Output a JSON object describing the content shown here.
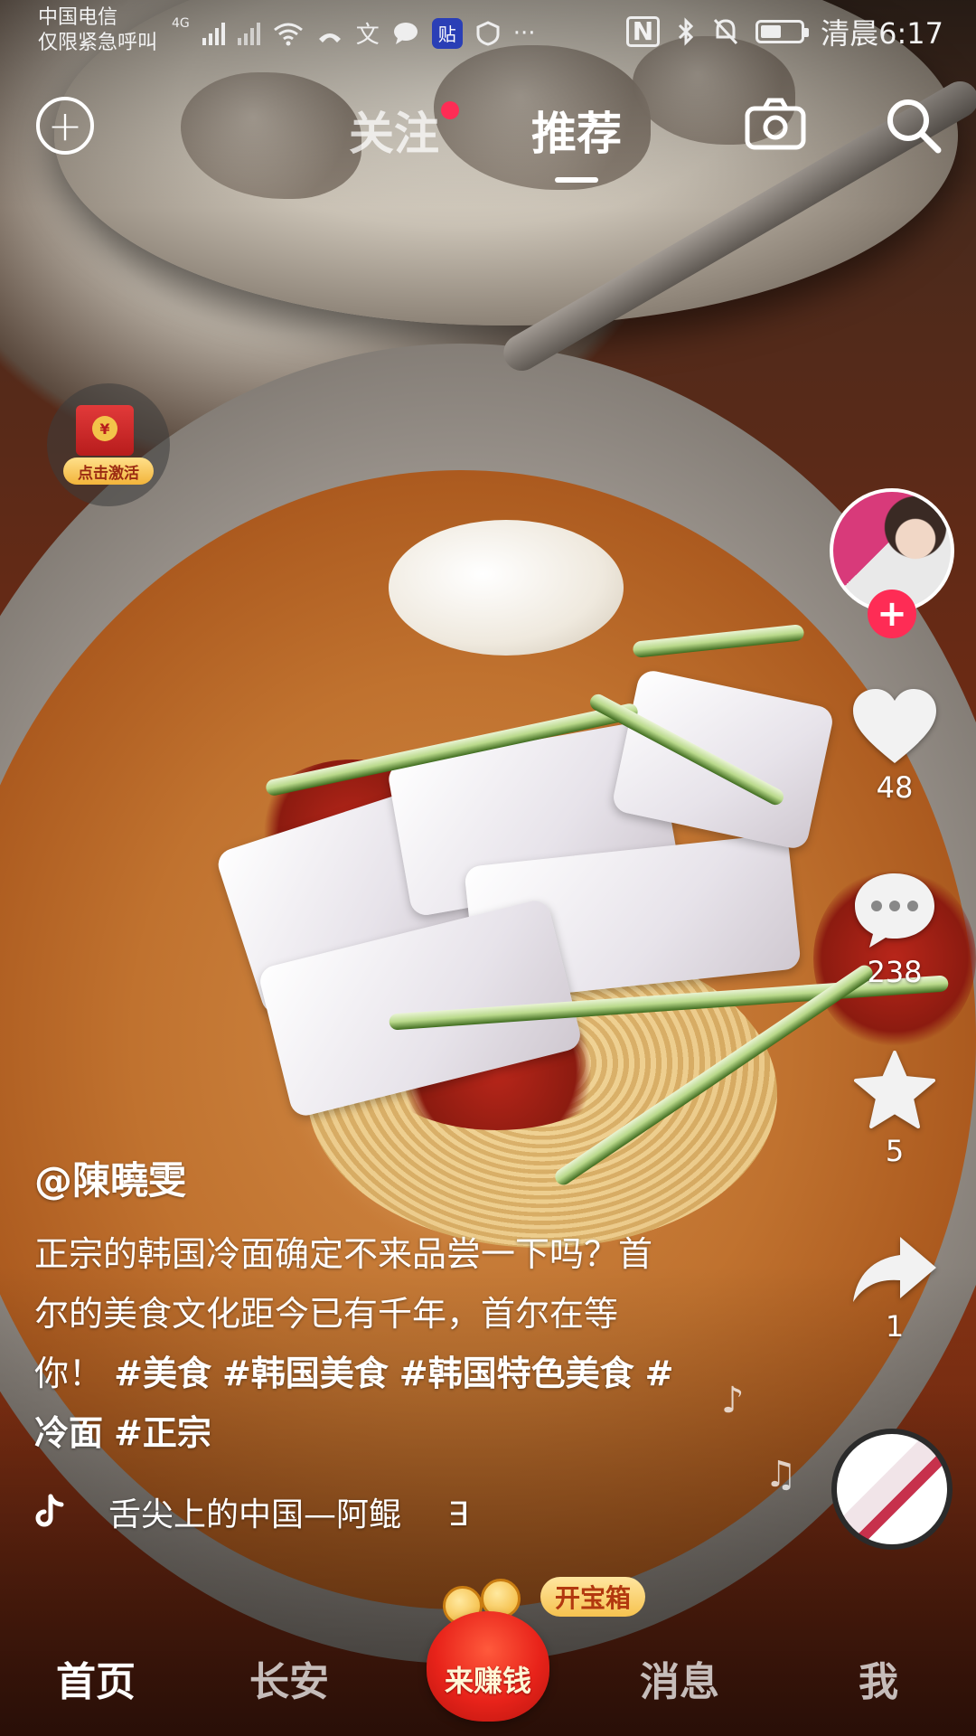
{
  "status_bar": {
    "carrier_line1": "中国电信",
    "carrier_line2": "仅限紧急呼叫",
    "network_label": "4G",
    "app_badge": "贴",
    "more": "···",
    "time": "清晨6:17"
  },
  "top_nav": {
    "tabs": [
      {
        "label": "关注",
        "has_dot": true
      },
      {
        "label": "推荐",
        "active": true
      }
    ]
  },
  "promo": {
    "redpack_label": "点击激活",
    "coin_symbol": "¥"
  },
  "video": {
    "author": "@陳曉雯",
    "caption_text": "正宗的韩国冷面确定不来品尝一下吗？首尔的美食文化距今已有千年，首尔在等你！",
    "hashtags": [
      "#美食",
      "#韩国美食",
      "#韩国特色美食",
      "#冷面",
      "#正宗"
    ],
    "music_track": "舌尖上的中国—阿鲲",
    "music_tail": "∃"
  },
  "actions": {
    "likes": "48",
    "comments": "238",
    "favorites": "5",
    "shares": "1"
  },
  "bottom_tabs": {
    "home": "首页",
    "city": "长安",
    "earn": "来赚钱",
    "chest": "开宝箱",
    "messages": "消息",
    "me": "我"
  },
  "colors": {
    "accent_red": "#fe2c55",
    "gold": "#f6c24f"
  }
}
